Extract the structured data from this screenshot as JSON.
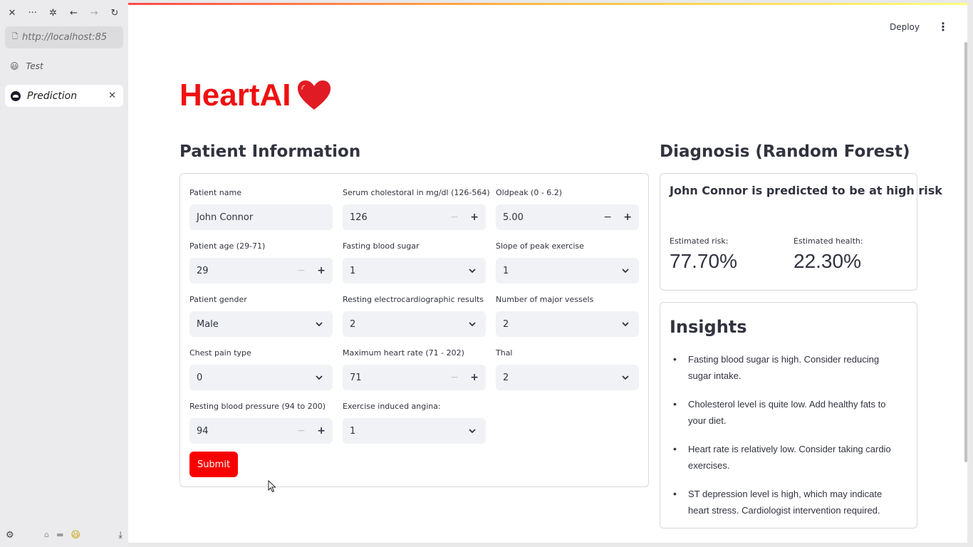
{
  "browser": {
    "url": "http://localhost:85",
    "tabs": [
      {
        "label": "Test",
        "emoji": "😃"
      },
      {
        "label": "Prediction"
      }
    ],
    "icons": {
      "close": "✕",
      "more": "···",
      "extensions": "✲",
      "back": "←",
      "forward": "→",
      "reload": "↻",
      "page": "🗋",
      "tab_close": "✕",
      "settings": "⚙",
      "bottom_emoji": "😃",
      "download": "⤓"
    }
  },
  "header": {
    "deploy_label": "Deploy",
    "menu_icon": "⋮"
  },
  "app": {
    "title": "HeartAI"
  },
  "patient": {
    "section_title": "Patient Information",
    "fields": {
      "name": {
        "label": "Patient name",
        "value": "John Connor"
      },
      "age": {
        "label": "Patient age (29-71)",
        "value": "29"
      },
      "gender": {
        "label": "Patient gender",
        "value": "Male"
      },
      "chest_pain": {
        "label": "Chest pain type",
        "value": "0"
      },
      "bp": {
        "label": "Resting blood pressure (94 to 200)",
        "value": "94"
      },
      "chol": {
        "label": "Serum cholestoral in mg/dl (126-564)",
        "value": "126"
      },
      "fbs": {
        "label": "Fasting blood sugar",
        "value": "1"
      },
      "ecg": {
        "label": "Resting electrocardiographic results",
        "value": "2"
      },
      "maxhr": {
        "label": "Maximum heart rate (71 - 202)",
        "value": "71"
      },
      "angina": {
        "label": "Exercise induced angina:",
        "value": "1"
      },
      "oldpeak": {
        "label": "Oldpeak (0 - 6.2)",
        "value": "5.00"
      },
      "slope": {
        "label": "Slope of peak exercise",
        "value": "1"
      },
      "vessels": {
        "label": "Number of major vessels",
        "value": "2"
      },
      "thal": {
        "label": "Thal",
        "value": "2"
      }
    },
    "stepper": {
      "minus": "−",
      "plus": "+"
    },
    "submit_label": "Submit"
  },
  "diagnosis": {
    "section_title": "Diagnosis (Random Forest)",
    "message": "John Connor is predicted to be at high risk",
    "risk_label": "Estimated risk:",
    "risk_value": "77.70%",
    "health_label": "Estimated health:",
    "health_value": "22.30%"
  },
  "insights": {
    "title": "Insights",
    "items": [
      "Fasting blood sugar is high. Consider reducing sugar intake.",
      "Cholesterol level is quite low. Add healthy fats to your diet.",
      "Heart rate is relatively low. Consider taking cardio exercises.",
      "ST depression level is high, which may indicate heart stress. Cardiologist intervention required."
    ]
  },
  "colors": {
    "accent": "#ff0000",
    "title_red": "#ee1111",
    "input_bg": "#f0f2f6",
    "text": "#31333f"
  }
}
